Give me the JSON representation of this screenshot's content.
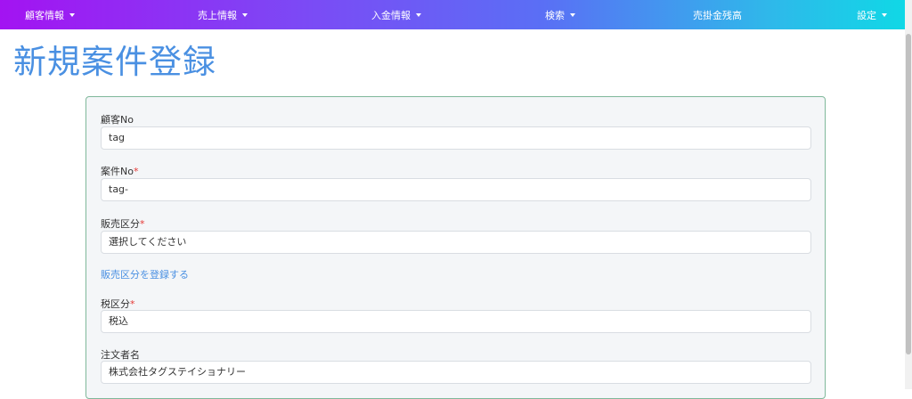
{
  "nav": {
    "items": [
      {
        "label": "顧客情報",
        "dropdown": true
      },
      {
        "label": "売上情報",
        "dropdown": true
      },
      {
        "label": "入金情報",
        "dropdown": true
      },
      {
        "label": "検索",
        "dropdown": true
      },
      {
        "label": "売掛金残高",
        "dropdown": false
      },
      {
        "label": "設定",
        "dropdown": true
      }
    ]
  },
  "page": {
    "title": "新規案件登録"
  },
  "form": {
    "customer_no": {
      "label": "顧客No",
      "value": "tag"
    },
    "project_no": {
      "label": "案件No",
      "required_mark": "*",
      "value": "tag-"
    },
    "sales_category": {
      "label": "販売区分",
      "required_mark": "*",
      "value": "選択してください"
    },
    "register_sales_category_link": "販売区分を登録する",
    "tax_category": {
      "label": "税区分",
      "required_mark": "*",
      "value": "税込"
    },
    "orderer_name": {
      "label": "注文者名",
      "value": "株式会社タグステイショナリー"
    }
  },
  "colors": {
    "title": "#4a90e2",
    "link": "#4a90e2",
    "required": "#e53935",
    "card_border": "#7fb89a"
  }
}
